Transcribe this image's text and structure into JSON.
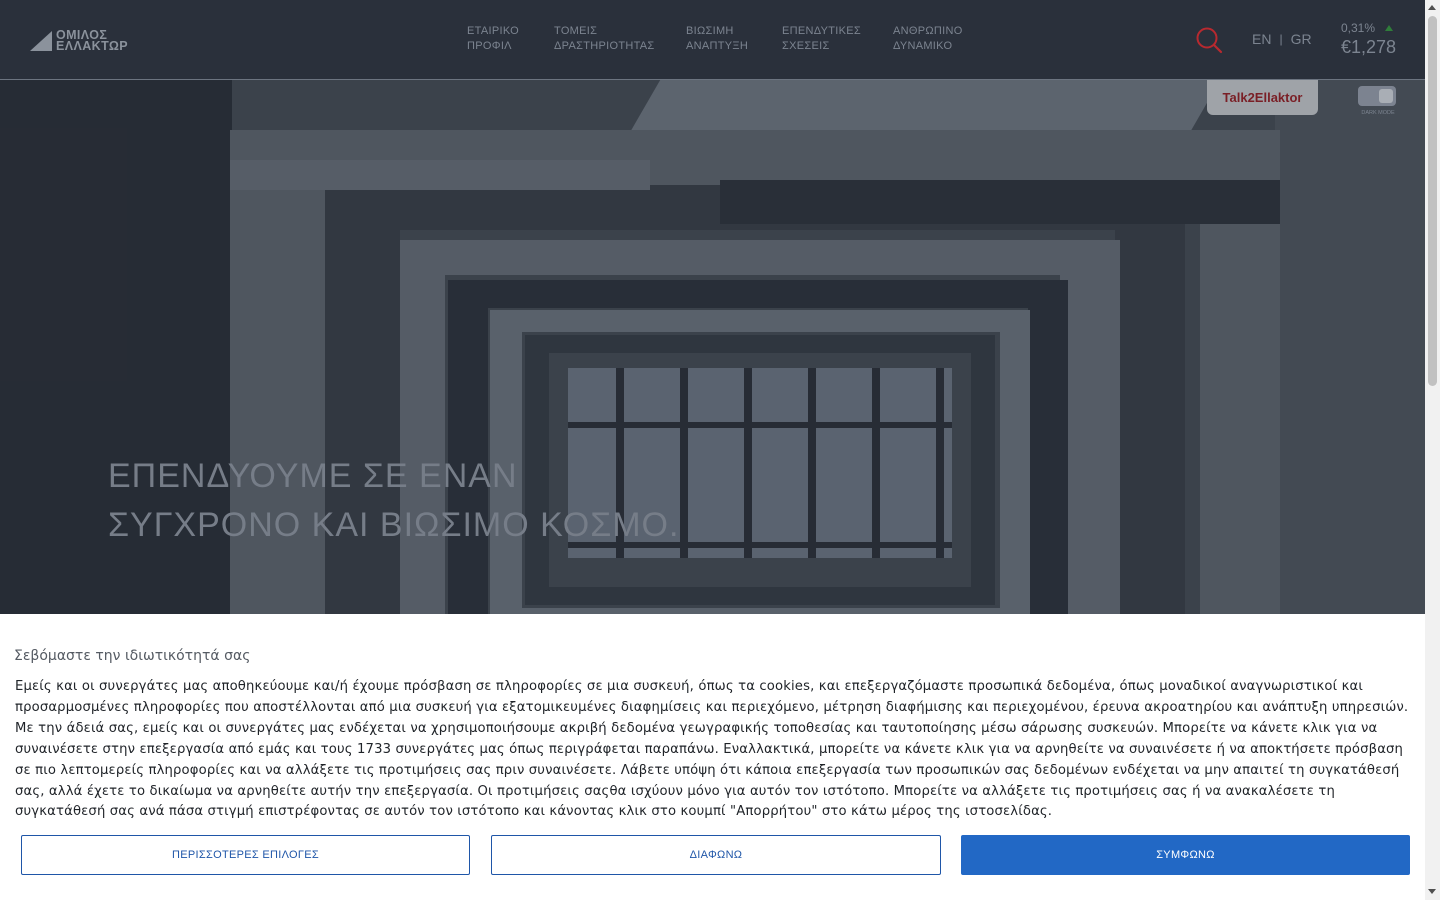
{
  "header": {
    "logo_line1": "ΟΜΙΛΟΣ",
    "logo_line2": "ΕΛΛΑΚΤΩΡ",
    "nav": [
      {
        "line1": "ΕΤΑΙΡΙΚΟ",
        "line2": "ΠΡΟΦΙΛ"
      },
      {
        "line1": "ΤΟΜΕΙΣ",
        "line2": "ΔΡΑΣΤΗΡΙΟΤΗΤΑΣ"
      },
      {
        "line1": "ΒΙΩΣΙΜΗ",
        "line2": "ΑΝΑΠΤΥΞΗ"
      },
      {
        "line1": "ΕΠΕΝΔΥΤΙΚΕΣ",
        "line2": "ΣΧΕΣΕΙΣ"
      },
      {
        "line1": "ΑΝΘΡΩΠΙΝΟ",
        "line2": "ΔΥΝΑΜΙΚΟ"
      }
    ],
    "search_icon": "search-icon",
    "lang_en": "EN",
    "lang_separator": "|",
    "lang_gr": "GR",
    "stock_change": "0,31%",
    "stock_price": "€1,278",
    "talk_button": "Talk2Ellaktor",
    "dark_mode_label": "DARK MODE"
  },
  "hero": {
    "title_line1": "ΕΠΕΝΔΥΟΥΜΕ ΣΕ ΕΝΑΝ",
    "title_line2": "ΣΥΓΧΡΟΝΟ ΚΑΙ ΒΙΩΣΙΜΟ ΚΟΣΜΟ."
  },
  "consent": {
    "title": "Σεβόμαστε την ιδιωτικότητά σας",
    "body": "Εμείς και οι συνεργάτες μας αποθηκεύουμε και/ή έχουμε πρόσβαση σε πληροφορίες σε μια συσκευή, όπως τα cookies, και επεξεργαζόμαστε προσωπικά δεδομένα, όπως μοναδικοί αναγνωριστικοί και προσαρμοσμένες πληροφορίες που αποστέλλονται από μια συσκευή για εξατομικευμένες διαφημίσεις και περιεχόμενο, μέτρηση διαφήμισης και περιεχομένου, έρευνα ακροατηρίου και ανάπτυξη υπηρεσιών. Με την άδειά σας, εμείς και οι συνεργάτες μας ενδέχεται να χρησιμοποιήσουμε ακριβή δεδομένα γεωγραφικής τοποθεσίας και ταυτοποίησης μέσω σάρωσης συσκευών. Μπορείτε να κάνετε κλικ για να συναινέσετε στην επεξεργασία από εμάς και τους 1733 συνεργάτες μας όπως περιγράφεται παραπάνω. Εναλλακτικά, μπορείτε να κάνετε κλικ για να αρνηθείτε να συναινέσετε ή να αποκτήσετε πρόσβαση σε πιο λεπτομερείς πληροφορίες και να αλλάξετε τις προτιμήσεις σας πριν συναινέσετε. Λάβετε υπόψη ότι κάποια επεξεργασία των προσωπικών σας δεδομένων ενδέχεται να μην απαιτεί τη συγκατάθεσή σας, αλλά έχετε το δικαίωμα να αρνηθείτε αυτήν την επεξεργασία. Οι προτιμήσεις σαςθα ισχύουν μόνο για αυτόν τον ιστότοπο. Μπορείτε να αλλάξετε τις προτιμήσεις σας ή να ανακαλέσετε τη συγκατάθεσή σας ανά πάσα στιγμή επιστρέφοντας σε αυτόν τον ιστότοπο και κάνοντας κλικ στο κουμπί \"Απορρήτου\" στο κάτω μέρος της ιστοσελίδας.",
    "more_options": "ΠΕΡΙΣΣΟΤΕΡΕΣ ΕΠΙΛΟΓΕΣ",
    "disagree": "ΔΙΑΦΩΝΩ",
    "agree": "ΣΥΜΦΩΝΩ"
  },
  "colors": {
    "header_bg": "#2a303b",
    "accent_red": "#c0262e",
    "button_blue": "#2268c5",
    "stock_up_green": "#2f7d3a"
  }
}
